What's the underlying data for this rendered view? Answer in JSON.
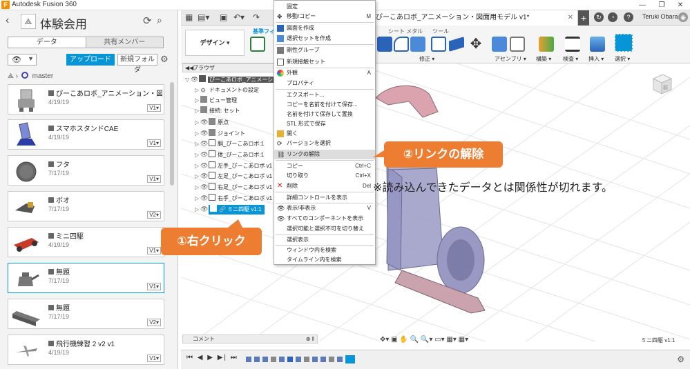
{
  "window": {
    "title": "Autodesk Fusion 360",
    "logo": "F",
    "controls": [
      "—",
      "❐",
      "✕"
    ]
  },
  "data_panel": {
    "back_icon": "chevron-left-icon",
    "hub_icon": "hub-icon",
    "project_title": "体験会用",
    "refresh_icon": "refresh-icon",
    "search_icon": "search-icon",
    "tabs": [
      {
        "label": "データ",
        "active": true
      },
      {
        "label": "共有メンバー",
        "active": false
      }
    ],
    "upload_label": "アップロード",
    "new_folder_label": "新規フォルダ",
    "breadcrumb": "master",
    "files": [
      {
        "name": "ぴーこあロボ_アニメーション・図面用...",
        "date": "4/19/19",
        "version": "V1▾",
        "selected": false
      },
      {
        "name": "スマホスタンドCAE",
        "date": "4/19/19",
        "version": "V1▾",
        "selected": false
      },
      {
        "name": "フタ",
        "date": "7/17/19",
        "version": "V1▾",
        "selected": false
      },
      {
        "name": "ボオ",
        "date": "7/17/19",
        "version": "V2▾",
        "selected": false
      },
      {
        "name": "ミニ四駆",
        "date": "4/19/19",
        "version": "V1▾",
        "selected": false
      },
      {
        "name": "無題",
        "date": "7/17/19",
        "version": "V1▾",
        "selected": true
      },
      {
        "name": "無題",
        "date": "7/17/19",
        "version": "V2▾",
        "selected": false
      },
      {
        "name": "飛行機練習 2 v2 v1",
        "date": "4/19/19",
        "version": "V1▾",
        "selected": false
      }
    ]
  },
  "main": {
    "doc_tab": "ぴーこあロボ_アニメーション・図面用モデル v1*",
    "user_name": "Teruki Obara",
    "design_dropdown": "デザイン ▾",
    "ribbon_tabs": [
      "基準フィ",
      "シート メタル",
      "ツール"
    ],
    "ribbon_groups": [
      "修正 ▾",
      "アセンブリ ▾",
      "構築 ▾",
      "検査 ▾",
      "挿入 ▾",
      "選択 ▾"
    ],
    "browser_title": "ブラウザ",
    "browser_nodes": [
      {
        "label": "ぴーこあロボ_アニメーシ",
        "level": 0
      },
      {
        "label": "ドキュメントの設定",
        "level": 1
      },
      {
        "label": "ビュー管理",
        "level": 1
      },
      {
        "label": "接続: セット",
        "level": 1
      },
      {
        "label": "原点",
        "level": 1
      },
      {
        "label": "ジョイント",
        "level": 1
      },
      {
        "label": "胴_ぴーこあロボ:1",
        "level": 1
      },
      {
        "label": "体_ぴーこあロボ:1",
        "level": 1
      },
      {
        "label": "左手_ぴーこあロボ v1",
        "level": 1
      },
      {
        "label": "左足_ぴーこあロボ v1",
        "level": 1
      },
      {
        "label": "右足_ぴーこあロボ v1",
        "level": 1
      },
      {
        "label": "右手_ぴーこあロボ v1",
        "level": 1
      },
      {
        "label": "ミニ四駆 v1:1",
        "level": 1,
        "selected": true
      }
    ],
    "comment_label": "コメント",
    "bottom_label": "ミニ四駆 v1:1"
  },
  "context_menu": {
    "items": [
      {
        "label": "固定",
        "shortcut": ""
      },
      {
        "label": "移動/コピー",
        "shortcut": "M"
      },
      {
        "label": "図面を作成",
        "shortcut": ""
      },
      {
        "label": "選択セットを作成",
        "shortcut": ""
      },
      {
        "label": "剛性グループ",
        "shortcut": ""
      },
      {
        "label": "新規接触セット",
        "shortcut": ""
      },
      {
        "label": "外観",
        "shortcut": "A"
      },
      {
        "label": "プロパティ",
        "shortcut": ""
      },
      {
        "label": "エクスポート...",
        "shortcut": ""
      },
      {
        "label": "コピーを名前を付けて保存...",
        "shortcut": ""
      },
      {
        "label": "名前を付けて保存して置換",
        "shortcut": ""
      },
      {
        "label": "STL 形式で保存",
        "shortcut": ""
      },
      {
        "label": "開く",
        "shortcut": ""
      },
      {
        "label": "バージョンを選択",
        "shortcut": ""
      },
      {
        "label": "リンクの解除",
        "shortcut": ""
      },
      {
        "label": "コピー",
        "shortcut": "Ctrl+C"
      },
      {
        "label": "切り取り",
        "shortcut": "Ctrl+X"
      },
      {
        "label": "削除",
        "shortcut": "Del"
      },
      {
        "label": "詳細コントロールを表示",
        "shortcut": ""
      },
      {
        "label": "表示/非表示",
        "shortcut": "V"
      },
      {
        "label": "すべてのコンポーネントを表示",
        "shortcut": ""
      },
      {
        "label": "選択可能と選択不可を切り替え",
        "shortcut": ""
      },
      {
        "label": "選択表示",
        "shortcut": ""
      },
      {
        "label": "ウィンドウ内を検索",
        "shortcut": ""
      },
      {
        "label": "タイムライン内を検索",
        "shortcut": ""
      }
    ]
  },
  "annotations": {
    "callout_right_click": "①右クリック",
    "callout_unlink": "②リンクの解除",
    "note": "※読み込んできたデータとは関係性が切れます。"
  },
  "colors": {
    "accent": "#0696d7",
    "callout": "#ed7d31",
    "logo": "#f29100"
  }
}
